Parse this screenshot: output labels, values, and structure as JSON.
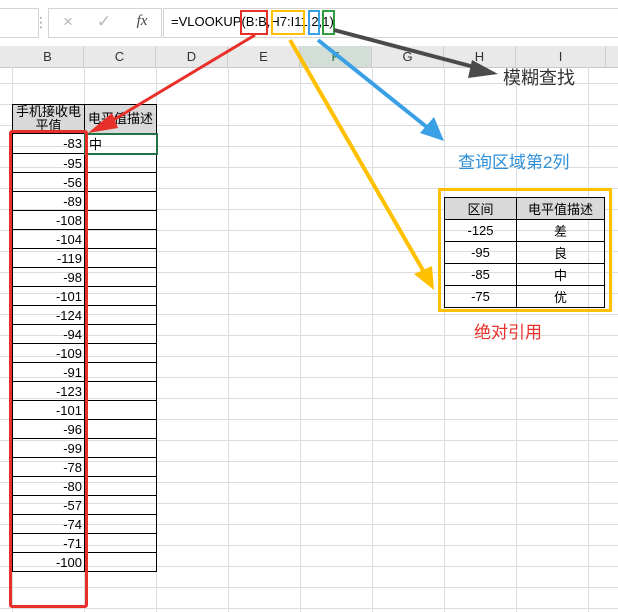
{
  "formula_bar": {
    "dots": "⋮",
    "cancel_icon": "×",
    "enter_icon": "✓",
    "fx_label": "fx",
    "formula_prefix": "=VLOOKUP(",
    "arg1": "B:B",
    "arg2": "H7:I11",
    "arg3": "2",
    "arg4": "1",
    "formula_suffix": ")"
  },
  "columns": [
    "B",
    "C",
    "D",
    "E",
    "F",
    "G",
    "H",
    "I"
  ],
  "selected_column": "F",
  "main_table": {
    "header_b": "手机接收电平值",
    "header_c": "电平值描述",
    "values": [
      "-83",
      "-95",
      "-56",
      "-89",
      "-108",
      "-104",
      "-119",
      "-98",
      "-101",
      "-124",
      "-94",
      "-109",
      "-91",
      "-123",
      "-101",
      "-96",
      "-99",
      "-78",
      "-80",
      "-57",
      "-74",
      "-71",
      "-100"
    ],
    "first_result": "中"
  },
  "lookup_table": {
    "header_a": "区间",
    "header_b": "电平值描述",
    "rows": [
      {
        "a": "-125",
        "b": "差"
      },
      {
        "a": "-95",
        "b": "良"
      },
      {
        "a": "-85",
        "b": "中"
      },
      {
        "a": "-75",
        "b": "优"
      }
    ]
  },
  "annotations": {
    "fuzzy": "模糊查找",
    "column2": "查询区域第2列",
    "absolute": "绝对引用"
  },
  "colors": {
    "red": "#e8302a",
    "orange": "#ffc000",
    "blue": "#3aa0e6",
    "green": "#2e9e3e",
    "gray": "#4a4a4a",
    "excel_green": "#217346"
  }
}
